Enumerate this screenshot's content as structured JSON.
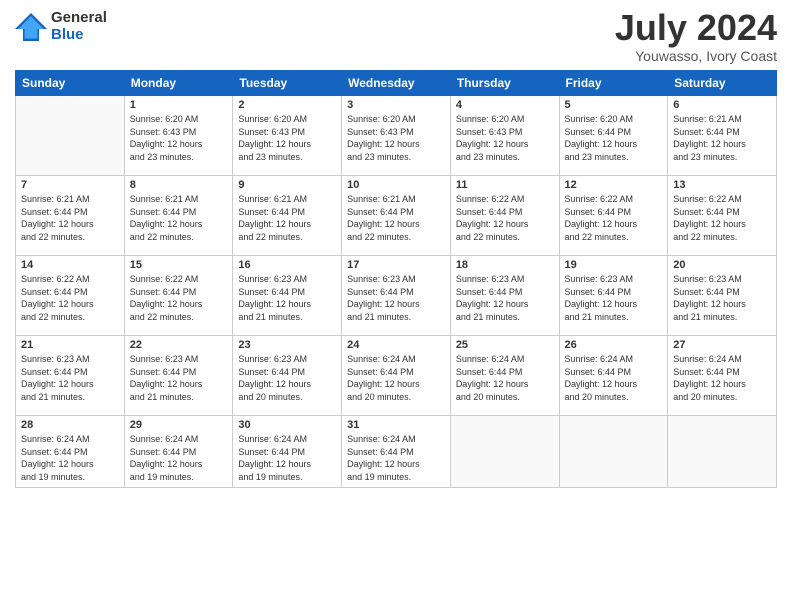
{
  "header": {
    "logo_general": "General",
    "logo_blue": "Blue",
    "month_title": "July 2024",
    "location": "Youwasso, Ivory Coast"
  },
  "calendar": {
    "days_of_week": [
      "Sunday",
      "Monday",
      "Tuesday",
      "Wednesday",
      "Thursday",
      "Friday",
      "Saturday"
    ],
    "weeks": [
      [
        {
          "num": "",
          "info": ""
        },
        {
          "num": "1",
          "info": "Sunrise: 6:20 AM\nSunset: 6:43 PM\nDaylight: 12 hours\nand 23 minutes."
        },
        {
          "num": "2",
          "info": "Sunrise: 6:20 AM\nSunset: 6:43 PM\nDaylight: 12 hours\nand 23 minutes."
        },
        {
          "num": "3",
          "info": "Sunrise: 6:20 AM\nSunset: 6:43 PM\nDaylight: 12 hours\nand 23 minutes."
        },
        {
          "num": "4",
          "info": "Sunrise: 6:20 AM\nSunset: 6:43 PM\nDaylight: 12 hours\nand 23 minutes."
        },
        {
          "num": "5",
          "info": "Sunrise: 6:20 AM\nSunset: 6:44 PM\nDaylight: 12 hours\nand 23 minutes."
        },
        {
          "num": "6",
          "info": "Sunrise: 6:21 AM\nSunset: 6:44 PM\nDaylight: 12 hours\nand 23 minutes."
        }
      ],
      [
        {
          "num": "7",
          "info": "Sunrise: 6:21 AM\nSunset: 6:44 PM\nDaylight: 12 hours\nand 22 minutes."
        },
        {
          "num": "8",
          "info": "Sunrise: 6:21 AM\nSunset: 6:44 PM\nDaylight: 12 hours\nand 22 minutes."
        },
        {
          "num": "9",
          "info": "Sunrise: 6:21 AM\nSunset: 6:44 PM\nDaylight: 12 hours\nand 22 minutes."
        },
        {
          "num": "10",
          "info": "Sunrise: 6:21 AM\nSunset: 6:44 PM\nDaylight: 12 hours\nand 22 minutes."
        },
        {
          "num": "11",
          "info": "Sunrise: 6:22 AM\nSunset: 6:44 PM\nDaylight: 12 hours\nand 22 minutes."
        },
        {
          "num": "12",
          "info": "Sunrise: 6:22 AM\nSunset: 6:44 PM\nDaylight: 12 hours\nand 22 minutes."
        },
        {
          "num": "13",
          "info": "Sunrise: 6:22 AM\nSunset: 6:44 PM\nDaylight: 12 hours\nand 22 minutes."
        }
      ],
      [
        {
          "num": "14",
          "info": "Sunrise: 6:22 AM\nSunset: 6:44 PM\nDaylight: 12 hours\nand 22 minutes."
        },
        {
          "num": "15",
          "info": "Sunrise: 6:22 AM\nSunset: 6:44 PM\nDaylight: 12 hours\nand 22 minutes."
        },
        {
          "num": "16",
          "info": "Sunrise: 6:23 AM\nSunset: 6:44 PM\nDaylight: 12 hours\nand 21 minutes."
        },
        {
          "num": "17",
          "info": "Sunrise: 6:23 AM\nSunset: 6:44 PM\nDaylight: 12 hours\nand 21 minutes."
        },
        {
          "num": "18",
          "info": "Sunrise: 6:23 AM\nSunset: 6:44 PM\nDaylight: 12 hours\nand 21 minutes."
        },
        {
          "num": "19",
          "info": "Sunrise: 6:23 AM\nSunset: 6:44 PM\nDaylight: 12 hours\nand 21 minutes."
        },
        {
          "num": "20",
          "info": "Sunrise: 6:23 AM\nSunset: 6:44 PM\nDaylight: 12 hours\nand 21 minutes."
        }
      ],
      [
        {
          "num": "21",
          "info": "Sunrise: 6:23 AM\nSunset: 6:44 PM\nDaylight: 12 hours\nand 21 minutes."
        },
        {
          "num": "22",
          "info": "Sunrise: 6:23 AM\nSunset: 6:44 PM\nDaylight: 12 hours\nand 21 minutes."
        },
        {
          "num": "23",
          "info": "Sunrise: 6:23 AM\nSunset: 6:44 PM\nDaylight: 12 hours\nand 20 minutes."
        },
        {
          "num": "24",
          "info": "Sunrise: 6:24 AM\nSunset: 6:44 PM\nDaylight: 12 hours\nand 20 minutes."
        },
        {
          "num": "25",
          "info": "Sunrise: 6:24 AM\nSunset: 6:44 PM\nDaylight: 12 hours\nand 20 minutes."
        },
        {
          "num": "26",
          "info": "Sunrise: 6:24 AM\nSunset: 6:44 PM\nDaylight: 12 hours\nand 20 minutes."
        },
        {
          "num": "27",
          "info": "Sunrise: 6:24 AM\nSunset: 6:44 PM\nDaylight: 12 hours\nand 20 minutes."
        }
      ],
      [
        {
          "num": "28",
          "info": "Sunrise: 6:24 AM\nSunset: 6:44 PM\nDaylight: 12 hours\nand 19 minutes."
        },
        {
          "num": "29",
          "info": "Sunrise: 6:24 AM\nSunset: 6:44 PM\nDaylight: 12 hours\nand 19 minutes."
        },
        {
          "num": "30",
          "info": "Sunrise: 6:24 AM\nSunset: 6:44 PM\nDaylight: 12 hours\nand 19 minutes."
        },
        {
          "num": "31",
          "info": "Sunrise: 6:24 AM\nSunset: 6:44 PM\nDaylight: 12 hours\nand 19 minutes."
        },
        {
          "num": "",
          "info": ""
        },
        {
          "num": "",
          "info": ""
        },
        {
          "num": "",
          "info": ""
        }
      ]
    ]
  }
}
